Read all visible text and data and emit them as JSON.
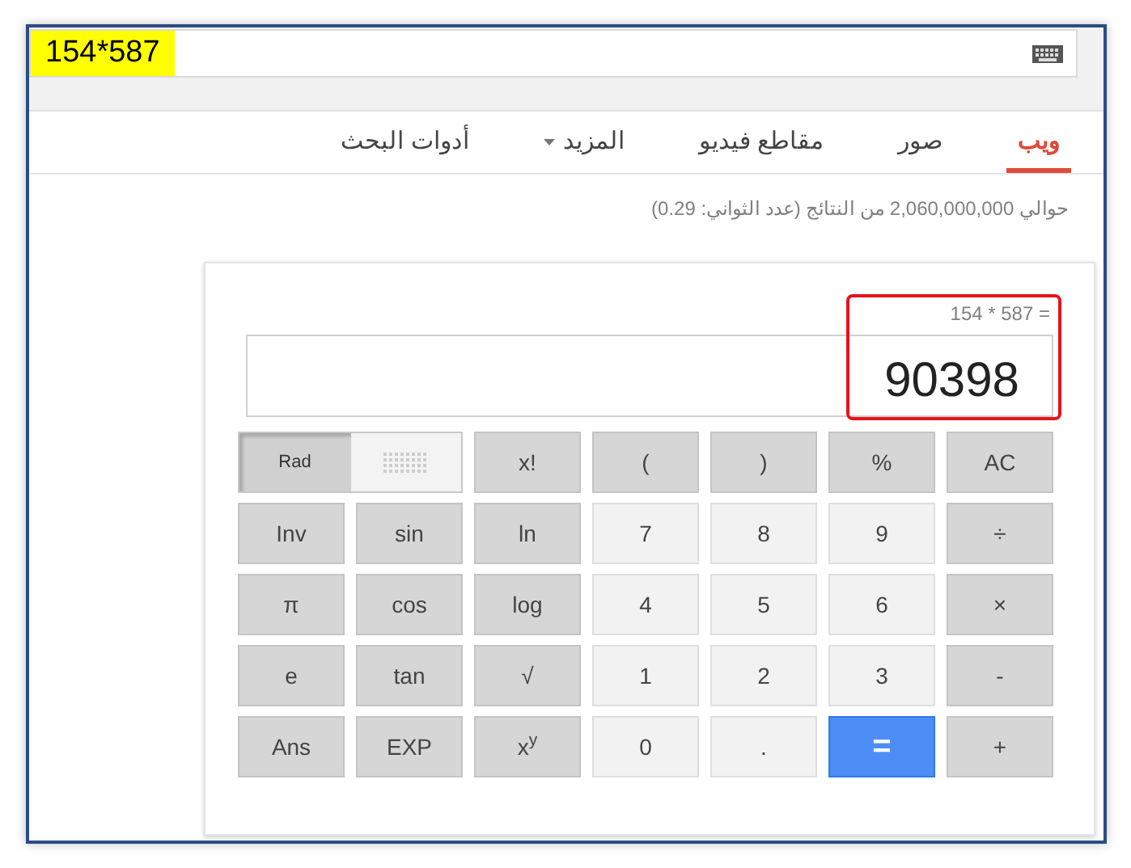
{
  "search": {
    "value": "154*587",
    "highlighted": true
  },
  "tabs": [
    {
      "label": "ويب",
      "selected": true,
      "has_menu": false
    },
    {
      "label": "صور",
      "selected": false,
      "has_menu": false
    },
    {
      "label": "مقاطع فيديو",
      "selected": false,
      "has_menu": false
    },
    {
      "label": "المزيد",
      "selected": false,
      "has_menu": true
    },
    {
      "label": "أدوات البحث",
      "selected": false,
      "has_menu": false
    }
  ],
  "result_stats": "حوالي 2,060,000,000 من النتائج (عدد الثواني: 0.29)",
  "calculator": {
    "expression": "154 * 587 =",
    "result": "90398",
    "highlighted": true,
    "buttons": [
      {
        "label": "AC",
        "kind": "func"
      },
      {
        "label": "%",
        "kind": "func"
      },
      {
        "label": ")",
        "kind": "func"
      },
      {
        "label": "(",
        "kind": "func"
      },
      {
        "label": "x!",
        "kind": "func"
      },
      {
        "label": "Rad",
        "kind": "toggle",
        "selected": true
      },
      {
        "label": "÷",
        "kind": "func"
      },
      {
        "label": "9",
        "kind": "digit"
      },
      {
        "label": "8",
        "kind": "digit"
      },
      {
        "label": "7",
        "kind": "digit"
      },
      {
        "label": "ln",
        "kind": "func"
      },
      {
        "label": "sin",
        "kind": "func"
      },
      {
        "label": "Inv",
        "kind": "func"
      },
      {
        "label": "×",
        "kind": "func"
      },
      {
        "label": "6",
        "kind": "digit"
      },
      {
        "label": "5",
        "kind": "digit"
      },
      {
        "label": "4",
        "kind": "digit"
      },
      {
        "label": "log",
        "kind": "func"
      },
      {
        "label": "cos",
        "kind": "func"
      },
      {
        "label": "π",
        "kind": "func"
      },
      {
        "label": "-",
        "kind": "func"
      },
      {
        "label": "3",
        "kind": "digit"
      },
      {
        "label": "2",
        "kind": "digit"
      },
      {
        "label": "1",
        "kind": "digit"
      },
      {
        "label": "√",
        "kind": "func"
      },
      {
        "label": "tan",
        "kind": "func"
      },
      {
        "label": "e",
        "kind": "func"
      },
      {
        "label": "+",
        "kind": "func"
      },
      {
        "label": "=",
        "kind": "equals"
      },
      {
        "label": ".",
        "kind": "digit"
      },
      {
        "label": "0",
        "kind": "digit"
      },
      {
        "label": "x$^{y}$",
        "kind": "func"
      },
      {
        "label": "EXP",
        "kind": "func"
      },
      {
        "label": "Ans",
        "kind": "func"
      }
    ]
  }
}
